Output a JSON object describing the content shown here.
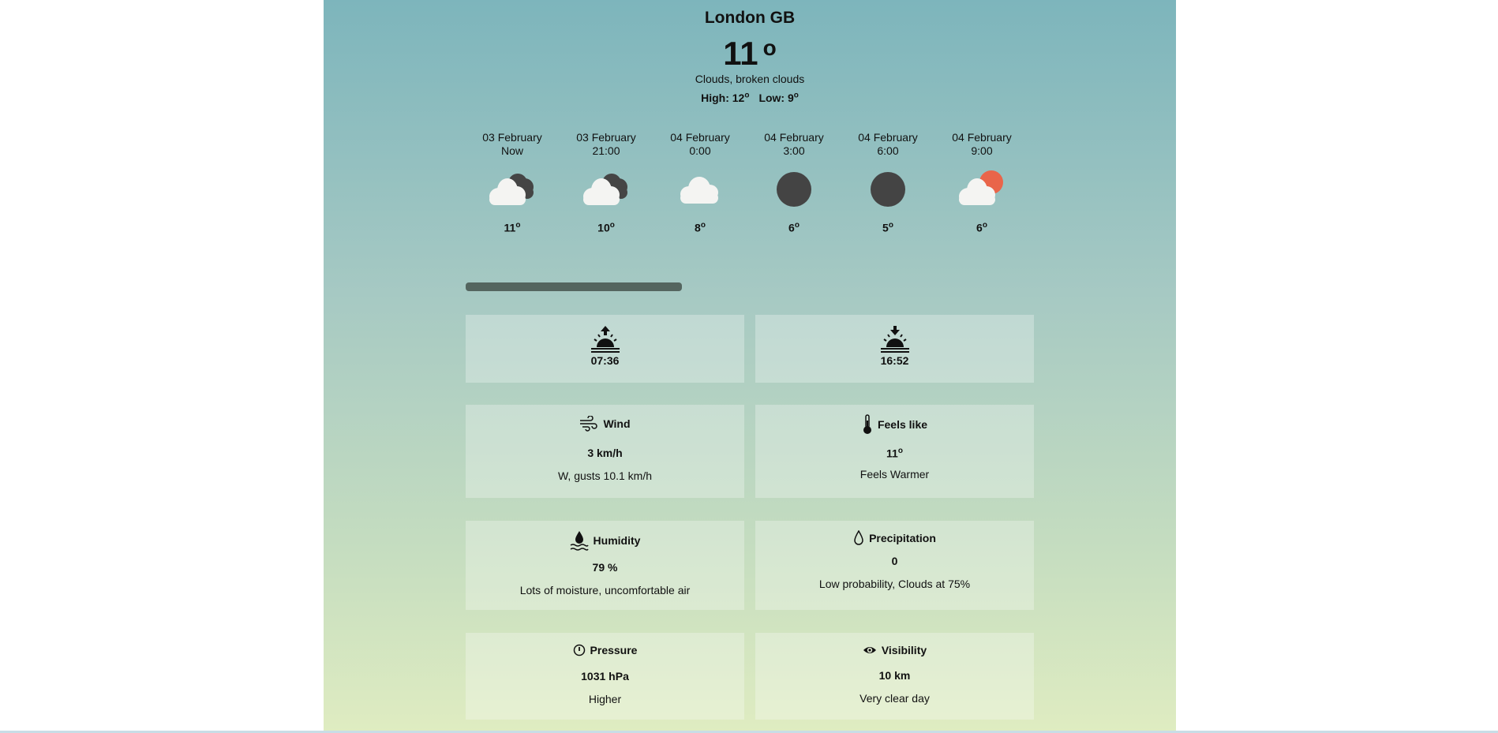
{
  "location": {
    "city": "London GB"
  },
  "current": {
    "temp": "11",
    "deg": "o",
    "description": "Clouds, broken clouds",
    "high_label": "High: 12",
    "low_label": "Low: 9",
    "deg_small": "o"
  },
  "forecast": [
    {
      "date": "03 February",
      "time": "Now",
      "temp": "11",
      "icon": "broken-clouds-icon"
    },
    {
      "date": "03 February",
      "time": "21:00",
      "temp": "10",
      "icon": "broken-clouds-icon"
    },
    {
      "date": "04 February",
      "time": "0:00",
      "temp": "8",
      "icon": "cloud-icon"
    },
    {
      "date": "04 February",
      "time": "3:00",
      "temp": "6",
      "icon": "moon-icon"
    },
    {
      "date": "04 February",
      "time": "6:00",
      "temp": "5",
      "icon": "moon-icon"
    },
    {
      "date": "04 February",
      "time": "9:00",
      "temp": "6",
      "icon": "sun-cloud-icon"
    }
  ],
  "sun": {
    "sunrise": "07:36",
    "sunset": "16:52"
  },
  "cards": {
    "wind": {
      "title": "Wind",
      "value": "3 km/h",
      "note": "W, gusts 10.1 km/h"
    },
    "feels": {
      "title": "Feels like",
      "value": "11",
      "note": "Feels Warmer"
    },
    "humidity": {
      "title": "Humidity",
      "value": "79 %",
      "note": "Lots of moisture, uncomfortable air"
    },
    "precipitation": {
      "title": "Precipitation",
      "value": "0",
      "note": "Low probability, Clouds at 75%"
    },
    "pressure": {
      "title": "Pressure",
      "value": "1031 hPa",
      "note": "Higher"
    },
    "visibility": {
      "title": "Visibility",
      "value": "10 km",
      "note": "Very clear day"
    }
  },
  "colors": {
    "sun": "#e9654a",
    "dark_cloud": "#454545",
    "scrollbar": "#54655f"
  }
}
